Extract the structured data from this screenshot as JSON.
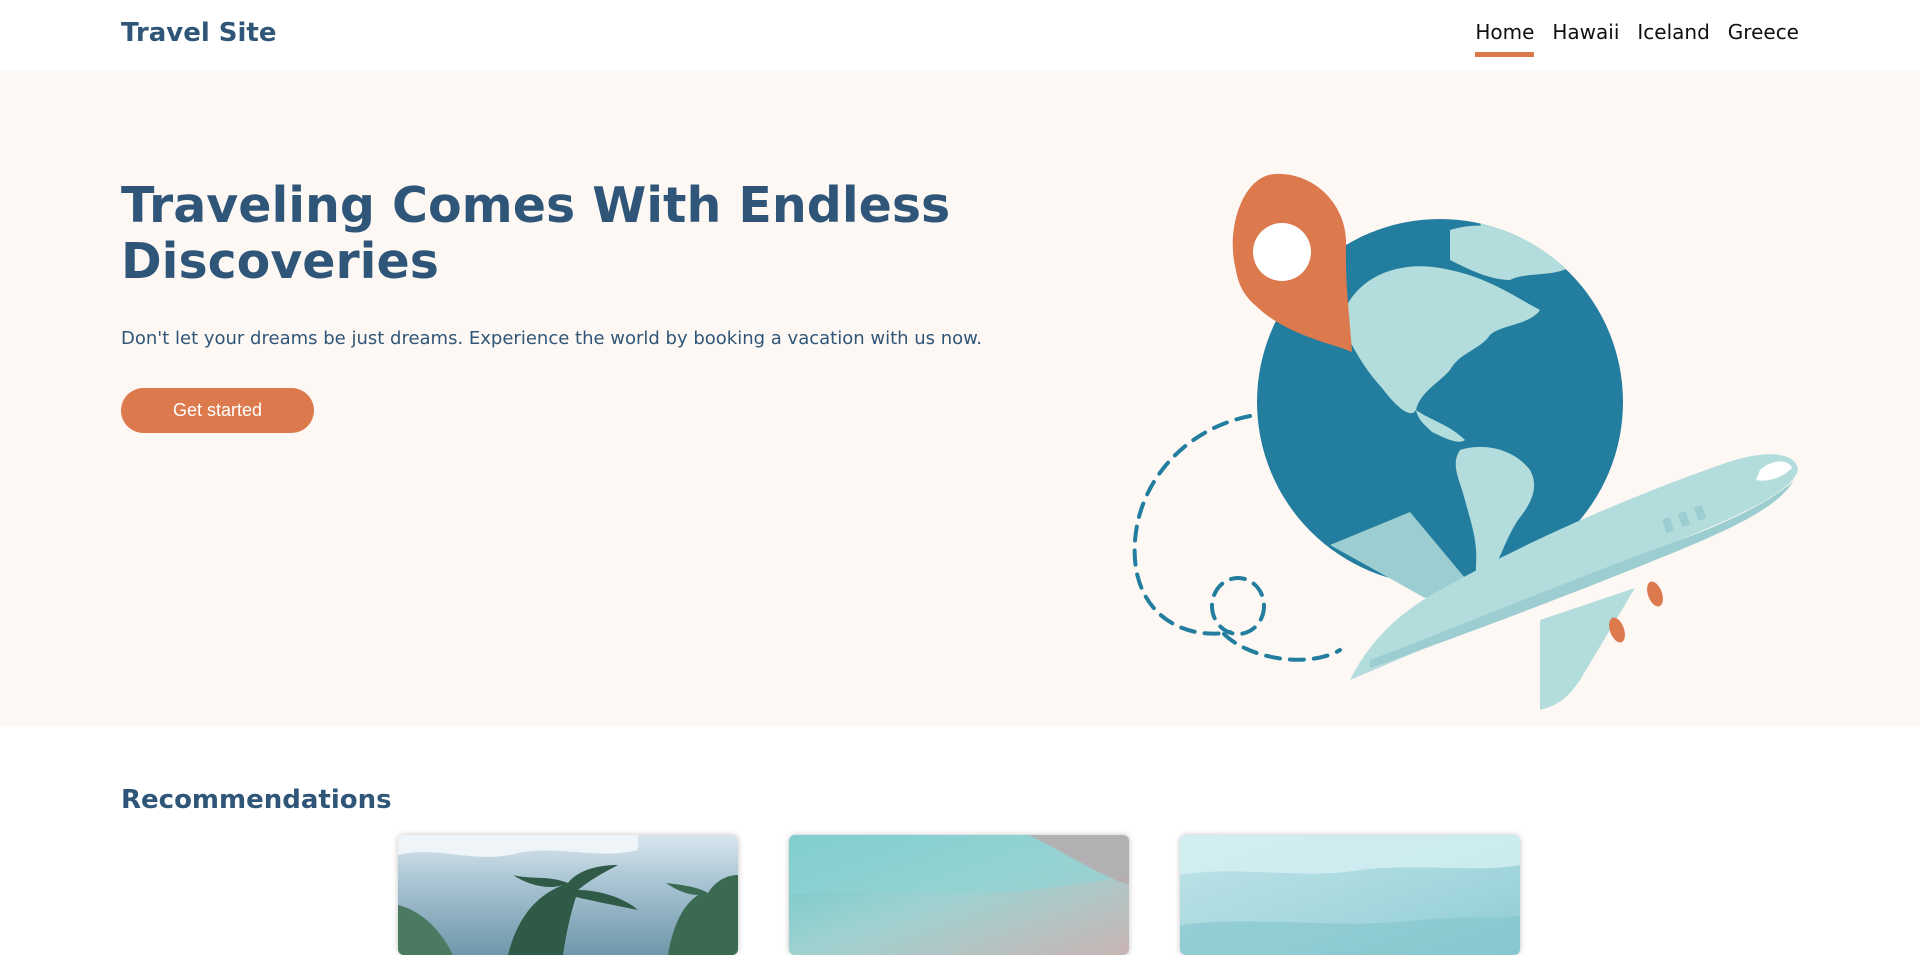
{
  "header": {
    "brand": "Travel Site",
    "nav": [
      {
        "label": "Home",
        "active": true
      },
      {
        "label": "Hawaii",
        "active": false
      },
      {
        "label": "Iceland",
        "active": false
      },
      {
        "label": "Greece",
        "active": false
      }
    ]
  },
  "hero": {
    "title": "Traveling Comes With Endless Discoveries",
    "subtitle": "Don't let your dreams be just dreams. Experience the world by booking a vacation with us now.",
    "cta_label": "Get started",
    "illustration_icons": [
      "map-pin-icon",
      "globe-icon",
      "airplane-icon",
      "dashed-flight-path"
    ]
  },
  "recommendations": {
    "title": "Recommendations",
    "cards": [
      {
        "image": "palm-trees-photo"
      },
      {
        "image": "lagoon-photo"
      },
      {
        "image": "sky-water-photo"
      }
    ]
  },
  "colors": {
    "primary_text": "#2f5678",
    "accent": "#dc7a4e",
    "hero_background": "#fdf8f4",
    "globe_ocean": "#227d9f",
    "globe_land": "#b3dcdd"
  }
}
